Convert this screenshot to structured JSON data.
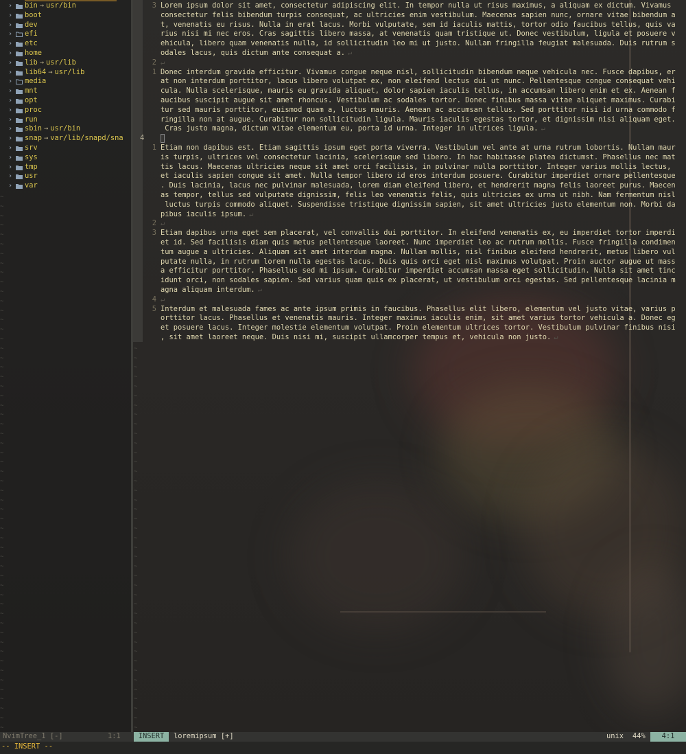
{
  "tree": {
    "entries": [
      {
        "name": "bin",
        "link": "usr/bin",
        "icon": "folder-icon"
      },
      {
        "name": "boot",
        "link": "",
        "icon": "folder-icon"
      },
      {
        "name": "dev",
        "link": "",
        "icon": "folder-icon"
      },
      {
        "name": "efi",
        "link": "",
        "icon": "folder-open-icon"
      },
      {
        "name": "etc",
        "link": "",
        "icon": "folder-icon"
      },
      {
        "name": "home",
        "link": "",
        "icon": "folder-icon"
      },
      {
        "name": "lib",
        "link": "usr/lib",
        "icon": "folder-icon"
      },
      {
        "name": "lib64",
        "link": "usr/lib",
        "icon": "folder-icon"
      },
      {
        "name": "media",
        "link": "",
        "icon": "folder-open-icon"
      },
      {
        "name": "mnt",
        "link": "",
        "icon": "folder-icon"
      },
      {
        "name": "opt",
        "link": "",
        "icon": "folder-icon"
      },
      {
        "name": "proc",
        "link": "",
        "icon": "folder-icon"
      },
      {
        "name": "run",
        "link": "",
        "icon": "folder-icon"
      },
      {
        "name": "sbin",
        "link": "usr/bin",
        "icon": "folder-icon"
      },
      {
        "name": "snap",
        "link": "var/lib/snapd/sna",
        "icon": "folder-icon"
      },
      {
        "name": "srv",
        "link": "",
        "icon": "folder-icon"
      },
      {
        "name": "sys",
        "link": "",
        "icon": "folder-icon"
      },
      {
        "name": "tmp",
        "link": "",
        "icon": "folder-icon"
      },
      {
        "name": "usr",
        "link": "",
        "icon": "folder-icon"
      },
      {
        "name": "var",
        "link": "",
        "icon": "folder-icon"
      }
    ],
    "link_arrow": "→",
    "expand_icon": "›"
  },
  "editor": {
    "lines": [
      {
        "num": "3",
        "text": "Lorem ipsum dolor sit amet, consectetur adipiscing elit. In tempor nulla ut risus maximus, a aliquam ex dictum. Vivamus"
      },
      {
        "num": "",
        "text": "consectetur felis bibendum turpis consequat, ac ultricies enim vestibulum. Maecenas sapien nunc, ornare vitae bibendum a"
      },
      {
        "num": "",
        "text": "t, venenatis eu risus. Nulla in erat lacus. Morbi vulputate, sem id iaculis mattis, tortor odio faucibus tellus, quis va"
      },
      {
        "num": "",
        "text": "rius nisi mi nec eros. Cras sagittis libero massa, at venenatis quam tristique ut. Donec vestibulum, ligula et posuere v"
      },
      {
        "num": "",
        "text": "ehicula, libero quam venenatis nulla, id sollicitudin leo mi ut justo. Nullam fringilla feugiat malesuada. Duis rutrum s"
      },
      {
        "num": "",
        "text": "odales lacus, quis dictum ante consequat a.",
        "eol": true
      },
      {
        "num": "2",
        "text": "",
        "eol": true
      },
      {
        "num": "1",
        "text": "Donec interdum gravida efficitur. Vivamus congue neque nisl, sollicitudin bibendum neque vehicula nec. Fusce dapibus, er"
      },
      {
        "num": "",
        "text": "at non interdum porttitor, lacus libero volutpat ex, non eleifend lectus dui ut nunc. Pellentesque congue consequat vehi"
      },
      {
        "num": "",
        "text": "cula. Nulla scelerisque, mauris eu gravida aliquet, dolor sapien iaculis tellus, in accumsan libero enim et ex. Aenean f"
      },
      {
        "num": "",
        "text": "aucibus suscipit augue sit amet rhoncus. Vestibulum ac sodales tortor. Donec finibus massa vitae aliquet maximus. Curabi"
      },
      {
        "num": "",
        "text": "tur sed mauris porttitor, euismod quam a, luctus mauris. Aenean ac accumsan tellus. Sed porttitor nisi id urna commodo f"
      },
      {
        "num": "",
        "text": "ringilla non at augue. Curabitur non sollicitudin ligula. Mauris iaculis egestas tortor, et dignissim nisi aliquam eget."
      },
      {
        "num": "",
        "text": " Cras justo magna, dictum vitae elementum eu, porta id urna. Integer in ultrices ligula.",
        "eol": true
      },
      {
        "num": "4",
        "text": "",
        "cursor": true
      },
      {
        "num": "1",
        "text": "Etiam non dapibus est. Etiam sagittis ipsum eget porta viverra. Vestibulum vel ante at urna rutrum lobortis. Nullam maur"
      },
      {
        "num": "",
        "text": "is turpis, ultrices vel consectetur lacinia, scelerisque sed libero. In hac habitasse platea dictumst. Phasellus nec mat"
      },
      {
        "num": "",
        "text": "tis lacus. Maecenas ultricies neque sit amet orci facilisis, in pulvinar nulla porttitor. Integer varius mollis lectus,"
      },
      {
        "num": "",
        "text": "et iaculis sapien congue sit amet. Nulla tempor libero id eros interdum posuere. Curabitur imperdiet ornare pellentesque"
      },
      {
        "num": "",
        "text": ". Duis lacinia, lacus nec pulvinar malesuada, lorem diam eleifend libero, et hendrerit magna felis laoreet purus. Maecen"
      },
      {
        "num": "",
        "text": "as tempor, tellus sed vulputate dignissim, felis leo venenatis felis, quis ultricies ex urna ut nibh. Nam fermentum nisl"
      },
      {
        "num": "",
        "text": " luctus turpis commodo aliquet. Suspendisse tristique dignissim sapien, sit amet ultricies justo elementum non. Morbi da"
      },
      {
        "num": "",
        "text": "pibus iaculis ipsum.",
        "eol": true
      },
      {
        "num": "2",
        "text": "",
        "eol": true
      },
      {
        "num": "3",
        "text": "Etiam dapibus urna eget sem placerat, vel convallis dui porttitor. In eleifend venenatis ex, eu imperdiet tortor imperdi"
      },
      {
        "num": "",
        "text": "et id. Sed facilisis diam quis metus pellentesque laoreet. Nunc imperdiet leo ac rutrum mollis. Fusce fringilla condimen"
      },
      {
        "num": "",
        "text": "tum augue a ultricies. Aliquam sit amet interdum magna. Nullam mollis, nisl finibus eleifend hendrerit, metus libero vul"
      },
      {
        "num": "",
        "text": "putate nulla, in rutrum lorem nulla egestas lacus. Duis quis orci eget nisl maximus volutpat. Proin auctor augue ut mass"
      },
      {
        "num": "",
        "text": "a efficitur porttitor. Phasellus sed mi ipsum. Curabitur imperdiet accumsan massa eget sollicitudin. Nulla sit amet tinc"
      },
      {
        "num": "",
        "text": "idunt orci, non sodales sapien. Sed varius quam quis ex placerat, ut vestibulum orci egestas. Sed pellentesque lacinia m"
      },
      {
        "num": "",
        "text": "agna aliquam interdum.",
        "eol": true
      },
      {
        "num": "4",
        "text": "",
        "eol": true
      },
      {
        "num": "5",
        "text": "Interdum et malesuada fames ac ante ipsum primis in faucibus. Phasellus elit libero, elementum vel justo vitae, varius p"
      },
      {
        "num": "",
        "text": "orttitor lacus. Phasellus et venenatis mauris. Integer maximus iaculis enim, sit amet varius tortor vehicula a. Donec eg"
      },
      {
        "num": "",
        "text": "et posuere lacus. Integer molestie elementum volutpat. Proin elementum ultrices tortor. Vestibulum pulvinar finibus nisi"
      },
      {
        "num": "",
        "text": ", sit amet laoreet neque. Duis nisi mi, suscipit ullamcorper tempus et, vehicula non justo.",
        "eol": true
      }
    ],
    "eol_char": "↵",
    "tilde": "~"
  },
  "status": {
    "tree_name": "NvimTree_1 [-]",
    "tree_pos": "1:1",
    "mode": "INSERT",
    "file": "loremipsum [+]",
    "fileformat": "unix",
    "percent": "44%",
    "position": "4:1"
  },
  "cmdline": "-- INSERT --",
  "colors": {
    "accent": "#e8a833",
    "folder": "#d8c34d",
    "mode_bg": "#8cb3a3"
  }
}
